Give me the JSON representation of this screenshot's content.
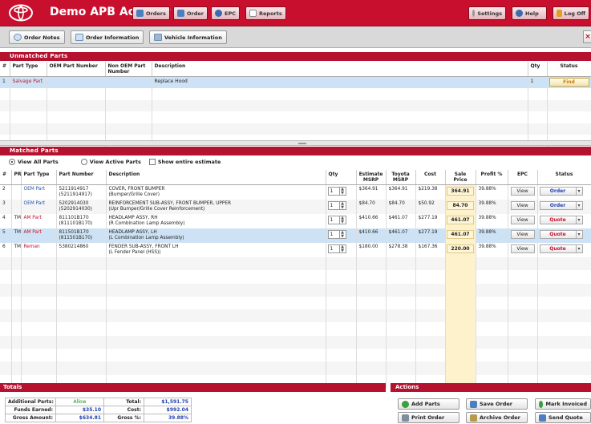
{
  "header": {
    "title": "Demo APB Account",
    "nav": [
      {
        "label": "Orders",
        "icon": "orders-icon"
      },
      {
        "label": "Order",
        "icon": "order-icon"
      },
      {
        "label": "EPC",
        "icon": "epc-icon"
      },
      {
        "label": "Reports",
        "icon": "reports-icon"
      }
    ],
    "right": [
      {
        "label": "Settings",
        "icon": "gear-icon"
      },
      {
        "label": "Help",
        "icon": "help-icon"
      },
      {
        "label": "Log Off",
        "icon": "logoff-icon"
      }
    ]
  },
  "toolbar": {
    "order_notes": "Order Notes",
    "order_information": "Order Information",
    "vehicle_information": "Vehicle Information",
    "close": "×"
  },
  "unmatched": {
    "title": "Unmatched Parts",
    "columns": [
      "#",
      "Part Type",
      "OEM Part Number",
      "Non OEM Part Number",
      "Description",
      "Qty",
      "Status"
    ],
    "rows": [
      {
        "num": "1",
        "part_type": "Salvage Part",
        "oem": "",
        "non_oem": "",
        "description": "Replace Hood",
        "qty": "1",
        "status": "Find"
      }
    ]
  },
  "matched": {
    "title": "Matched Parts",
    "filters": {
      "view_all": "View All Parts",
      "view_active": "View Active Parts",
      "show_entire": "Show entire estimate"
    },
    "columns": [
      "#",
      "PR",
      "Part Type",
      "Part Number",
      "Description",
      "Qty",
      "Estimate MSRP",
      "Toyota MSRP",
      "Cost",
      "Sale Price",
      "Profit %",
      "EPC",
      "Status"
    ],
    "rows": [
      {
        "num": "2",
        "pr": "",
        "part_type": "OEM Part",
        "pn1": "5211914917",
        "pn2": "(5211914917)",
        "d1": "COVER, FRONT BUMPER",
        "d2": "(Bumper/Grille Cover)",
        "qty": "1",
        "est": "$364.91",
        "toyota": "$364.91",
        "cost": "$219.38",
        "sale": "364.91",
        "profit": "39.88%",
        "epc": "View",
        "status": "Order"
      },
      {
        "num": "3",
        "pr": "",
        "part_type": "OEM Part",
        "pn1": "5202914030",
        "pn2": "(5202914030)",
        "d1": "REINFORCEMENT SUB-ASSY, FRONT BUMPER, UPPER",
        "d2": "(Upr Bumper/Grille Cover Reinforcement)",
        "qty": "1",
        "est": "$84.70",
        "toyota": "$84.70",
        "cost": "$50.92",
        "sale": "84.70",
        "profit": "39.88%",
        "epc": "View",
        "status": "Order"
      },
      {
        "num": "4",
        "pr": "TM",
        "part_type": "AM Part",
        "pn1": "811101B170",
        "pn2": "(811101B170)",
        "d1": "HEADLAMP ASSY, RH",
        "d2": "(R Combination Lamp Assembly)",
        "qty": "1",
        "est": "$410.66",
        "toyota": "$461.07",
        "cost": "$277.19",
        "sale": "461.07",
        "profit": "39.88%",
        "epc": "View",
        "status": "Quote"
      },
      {
        "num": "5",
        "pr": "TM",
        "part_type": "AM Part",
        "pn1": "811501B170",
        "pn2": "(811501B170)",
        "d1": "HEADLAMP ASSY, LH",
        "d2": "(L Combination Lamp Assembly)",
        "qty": "1",
        "est": "$410.66",
        "toyota": "$461.07",
        "cost": "$277.19",
        "sale": "461.07",
        "profit": "39.88%",
        "epc": "View",
        "status": "Quote"
      },
      {
        "num": "6",
        "pr": "TM",
        "part_type": "Reman",
        "pn1": "5380214860",
        "pn2": "",
        "d1": "FENDER SUB-ASSY, FRONT LH",
        "d2": "(L Fender Panel (HSS))",
        "qty": "1",
        "est": "$180.00",
        "toyota": "$278.38",
        "cost": "$167.36",
        "sale": "220.00",
        "profit": "39.88%",
        "epc": "View",
        "status": "Quote"
      }
    ]
  },
  "totals": {
    "title": "Totals",
    "additional_parts_label": "Additional Parts:",
    "additional_parts": "Allow",
    "total_label": "Total:",
    "total": "$1,591.75",
    "funds_earned_label": "Funds Earned:",
    "funds_earned": "$35.10",
    "cost_label": "Cost:",
    "cost": "$992.04",
    "gross_amount_label": "Gross Amount:",
    "gross_amount": "$634.81",
    "gross_pct_label": "Gross %:",
    "gross_pct": "39.88%"
  },
  "actions": {
    "title": "Actions",
    "add_parts": "Add Parts",
    "save_order": "Save Order",
    "mark_invoiced": "Mark Invoiced",
    "print_order": "Print Order",
    "archive_order": "Archive Order",
    "send_quote": "Send Quote"
  },
  "colors": {
    "brand_red": "#c8102e",
    "order_blue": "#1f3fb0",
    "find_orange": "#d07a00"
  }
}
